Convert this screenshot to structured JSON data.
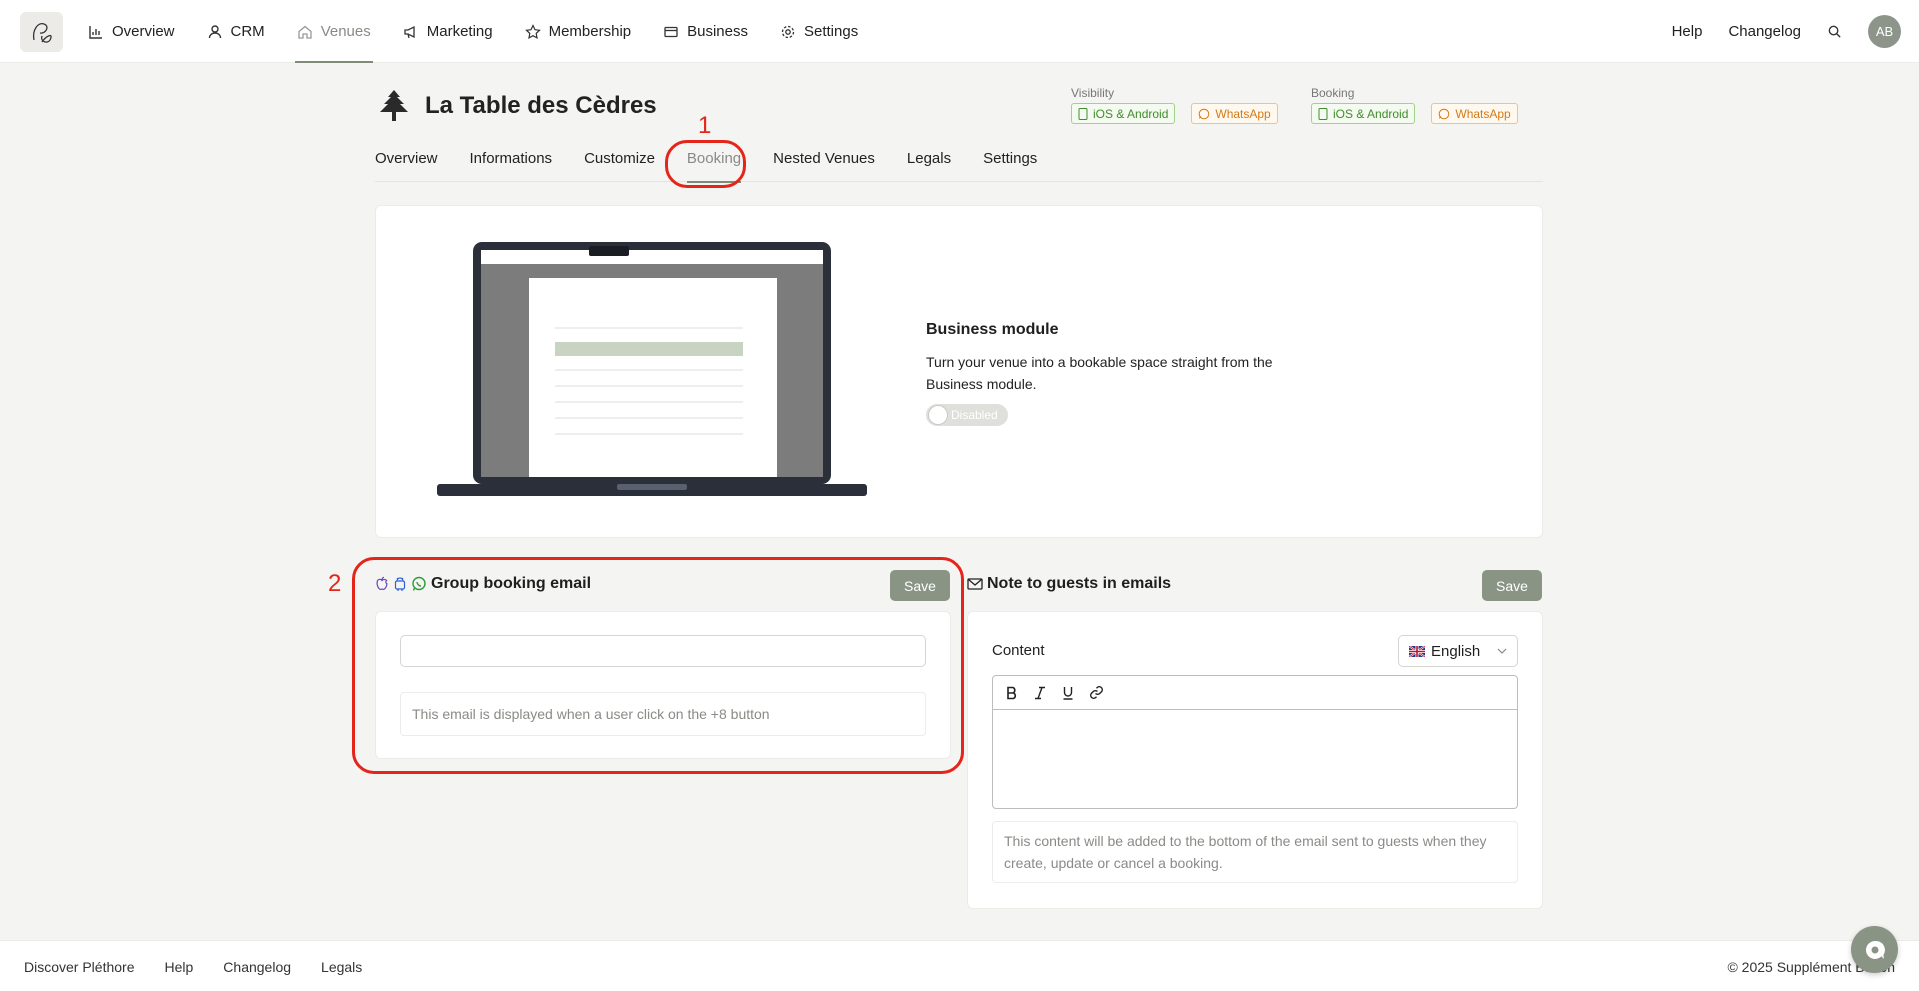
{
  "nav": {
    "items": [
      {
        "label": "Overview",
        "icon": "chart-icon"
      },
      {
        "label": "CRM",
        "icon": "user-icon"
      },
      {
        "label": "Venues",
        "icon": "home-icon",
        "active": true
      },
      {
        "label": "Marketing",
        "icon": "megaphone-icon"
      },
      {
        "label": "Membership",
        "icon": "star-icon"
      },
      {
        "label": "Business",
        "icon": "wallet-icon"
      },
      {
        "label": "Settings",
        "icon": "gear-icon"
      }
    ],
    "help": "Help",
    "changelog": "Changelog",
    "avatar": "AB"
  },
  "venue": {
    "title": "La Table des Cèdres",
    "visibility_label": "Visibility",
    "booking_label": "Booking",
    "badges": [
      "iOS & Android",
      "WhatsApp"
    ]
  },
  "tabs": [
    "Overview",
    "Informations",
    "Customize",
    "Booking",
    "Nested Venues",
    "Legals",
    "Settings"
  ],
  "annotations": {
    "one": "1",
    "two": "2"
  },
  "module": {
    "title": "Business module",
    "description": "Turn your venue into a bookable space straight from the Business module.",
    "toggle_label": "Disabled"
  },
  "group_booking": {
    "title": "Group booking email",
    "save": "Save",
    "input_value": "",
    "hint": "This email is displayed when a user click on the +8 button"
  },
  "note": {
    "title": "Note to guests in emails",
    "save": "Save",
    "content_label": "Content",
    "language": "English",
    "hint": "This content will be added to the bottom of the email sent to guests when they create, update or cancel a booking."
  },
  "footer": {
    "links": [
      "Discover Pléthore",
      "Help",
      "Changelog",
      "Legals"
    ],
    "copyright": "© 2025 Supplément Bacon"
  },
  "colors": {
    "accent": "#8a9485",
    "annotation": "#e5251a",
    "badge_green": "#3e8e2b",
    "badge_orange": "#d37b19"
  }
}
